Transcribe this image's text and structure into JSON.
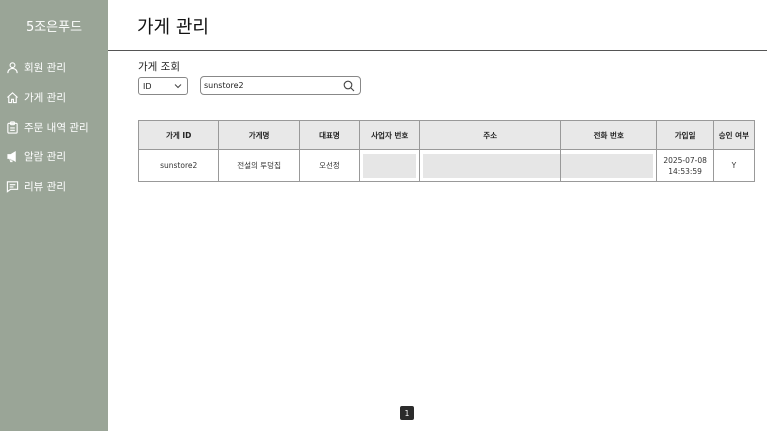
{
  "sidebar": {
    "brand": "5조은푸드",
    "items": [
      {
        "label": "회원 관리",
        "icon": "user-icon"
      },
      {
        "label": "가게 관리",
        "icon": "home-icon"
      },
      {
        "label": "주문 내역 관리",
        "icon": "clipboard-icon"
      },
      {
        "label": "알람 관리",
        "icon": "megaphone-icon"
      },
      {
        "label": "리뷰 관리",
        "icon": "chat-icon"
      }
    ]
  },
  "header": {
    "title": "가게 관리"
  },
  "search": {
    "section_label": "가게 조회",
    "filter_selected": "ID",
    "query": "sunstore2"
  },
  "table": {
    "columns": [
      "가게 ID",
      "가게명",
      "대표명",
      "사업자 번호",
      "주소",
      "전화 번호",
      "가입일",
      "승인 여부"
    ],
    "rows": [
      {
        "store_id": "sunstore2",
        "store_name": "전설의 투덩집",
        "owner": "오선정",
        "business_no": "",
        "address": "",
        "phone": "",
        "joined_date": "2025-07-08",
        "joined_time": "14:53:59",
        "approved": "Y"
      }
    ]
  },
  "pagination": {
    "current": "1"
  }
}
